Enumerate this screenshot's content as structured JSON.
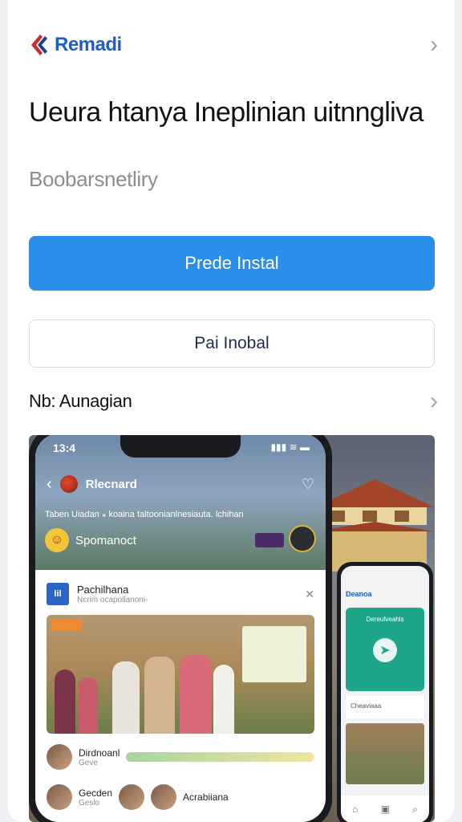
{
  "header": {
    "brand_name": "Remadi",
    "chevron": "›"
  },
  "hero": {
    "title": "Ueura htanya Ineplinian uitnngliva",
    "subtitle": "Boobarsnetliry"
  },
  "actions": {
    "primary_label": "Prede Instal",
    "secondary_label": "Pai Inobal"
  },
  "section": {
    "label": "Nb: Aunagian",
    "chevron": "›"
  },
  "phone_big": {
    "status_time": "13:4",
    "status_icons": "▮▮▮ ≋ ▬",
    "app_bar": {
      "back": "‹",
      "name": "Rlecnard",
      "heart": "♡"
    },
    "hero_caption": "Taben Uiadan ⁎ koaina taltoonianlnesiauta. lchihan",
    "hero_user": {
      "name": "Spomanoct",
      "emoji": "☺"
    },
    "post": {
      "logo": "lil",
      "title": "Pachilhana",
      "meta": "Ncrim ocapollanoni-",
      "close": "✕"
    },
    "rows": [
      {
        "label": "Dirdnoanl",
        "sub": "Geve"
      },
      {
        "label": "Gecden",
        "sub": "Geslo",
        "label2": "Acrabiiana"
      }
    ]
  },
  "phone_small": {
    "brand": "Deanoa",
    "card_label": "Dereufveahls",
    "compass": "➤",
    "field_text": "Cheaviaaa",
    "nav": [
      "⌂",
      "▣",
      "⌕"
    ]
  }
}
